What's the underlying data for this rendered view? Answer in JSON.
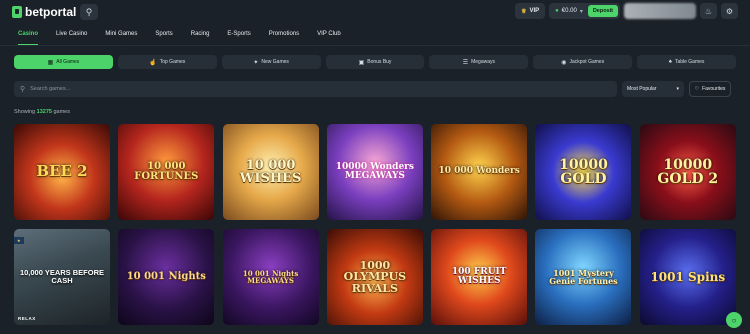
{
  "brand": {
    "name": "betportal"
  },
  "header": {
    "vip_label": "VIP",
    "balance": "€0.00",
    "deposit_label": "Deposit"
  },
  "nav": [
    "Casino",
    "Live Casino",
    "Mini Games",
    "Sports",
    "Racing",
    "E-Sports",
    "Promotions",
    "VIP Club"
  ],
  "categories": [
    {
      "label": "All Games",
      "icon": "grid-icon"
    },
    {
      "label": "Top Games",
      "icon": "thumb-icon"
    },
    {
      "label": "New Games",
      "icon": "sparkle-icon"
    },
    {
      "label": "Bonus Buy",
      "icon": "cart-icon"
    },
    {
      "label": "Megaways",
      "icon": "layers-icon"
    },
    {
      "label": "Jackpot Games",
      "icon": "coin-icon"
    },
    {
      "label": "Table Games",
      "icon": "cards-icon"
    }
  ],
  "search": {
    "placeholder": "Search games..."
  },
  "sort": {
    "value": "Most Popular"
  },
  "favourites_label": "Favourites",
  "results": {
    "prefix": "Showing",
    "count": "13275",
    "suffix": "games"
  },
  "games": [
    {
      "title": "BEE 2",
      "provider": ""
    },
    {
      "title": "10 000 FORTUNES",
      "provider": ""
    },
    {
      "title": "10 000 WISHES",
      "provider": ""
    },
    {
      "title": "10000 Wonders MEGAWAYS",
      "provider": ""
    },
    {
      "title": "10 000 Wonders",
      "provider": ""
    },
    {
      "title": "10000 GOLD",
      "provider": ""
    },
    {
      "title": "10000 GOLD 2",
      "provider": ""
    },
    {
      "title": "10,000 YEARS BEFORE CASH",
      "provider": "RELAX"
    },
    {
      "title": "10 001 Nights",
      "provider": ""
    },
    {
      "title": "10 001 Nights MEGAWAYS",
      "provider": ""
    },
    {
      "title": "1000 OLYMPUS RIVALS",
      "provider": ""
    },
    {
      "title": "100 FRUIT WISHES",
      "provider": ""
    },
    {
      "title": "1001 Mystery Genie Fortunes",
      "provider": ""
    },
    {
      "title": "1001 Spins",
      "provider": ""
    }
  ],
  "colors": {
    "accent": "#4cd36a",
    "bg": "#1b2128",
    "panel": "#262e37"
  }
}
